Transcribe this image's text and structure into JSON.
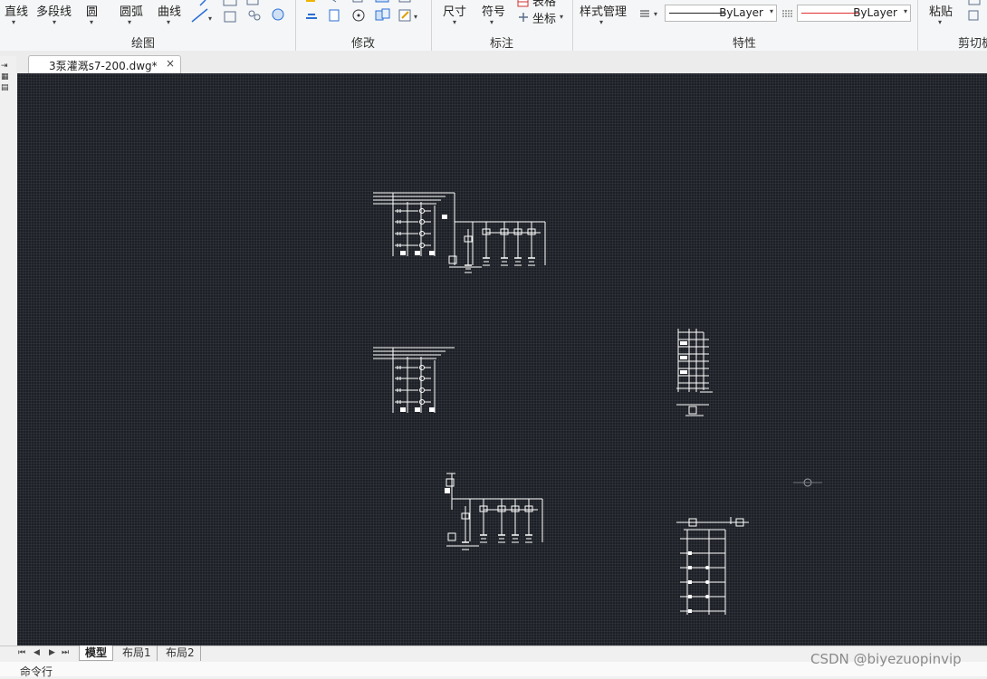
{
  "ribbon": {
    "draw": {
      "line": "直线",
      "polyline": "多段线",
      "circle": "圆",
      "arc": "圆弧",
      "curve": "曲线",
      "group_label": "绘图"
    },
    "modify": {
      "group_label": "修改"
    },
    "annotate": {
      "dimension": "尺寸",
      "symbol": "符号",
      "table": "表格",
      "coordinate": "坐标",
      "group_label": "标注"
    },
    "properties": {
      "style_manager": "样式管理",
      "layer_combo": "ByLayer",
      "color_combo": "ByLayer",
      "group_label": "特性"
    },
    "clipboard": {
      "paste": "粘贴",
      "group_label": "剪切板"
    },
    "colors": {
      "ribbon_bg": "#f5f6f7",
      "color_line": "#e03030"
    }
  },
  "document_tab": {
    "title": "3泵灌溉s7-200.dwg*",
    "close": "×"
  },
  "drawing": {
    "background": "#1c2026",
    "stroke": "#ffffff",
    "blocks": [
      "ladder-top",
      "ladder-middle",
      "ladder-bottom",
      "terminal-strip-right",
      "branch-circuit-right",
      "crosshair-cursor"
    ]
  },
  "layout_tabs": {
    "model": "模型",
    "layout1": "布局1",
    "layout2": "布局2",
    "nav": [
      "⏮",
      "◀",
      "▶",
      "⏭"
    ]
  },
  "command_line": {
    "label": "命令行"
  },
  "watermark": "CSDN @biyezuopinvip"
}
